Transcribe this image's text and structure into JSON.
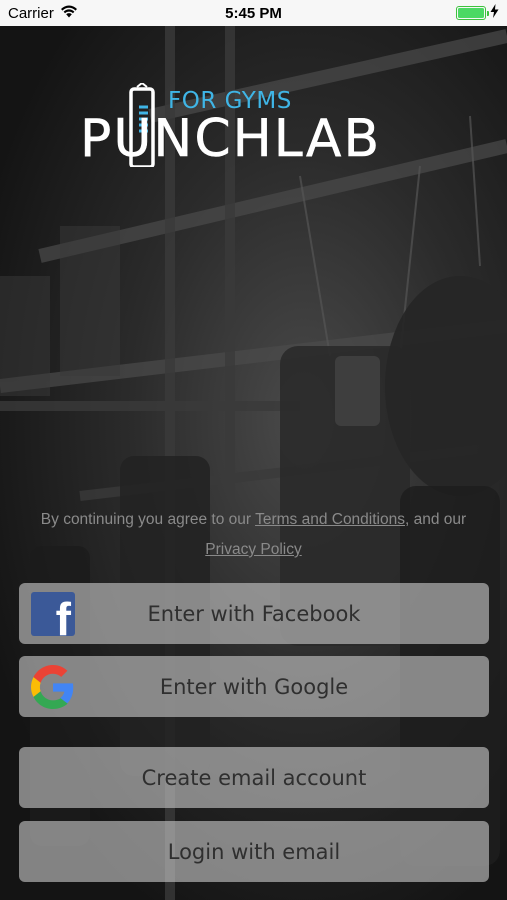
{
  "status_bar": {
    "carrier": "Carrier",
    "time": "5:45 PM",
    "battery_level": 1.0
  },
  "logo": {
    "subtitle": "FOR GYMS",
    "title": "PUNCHLAB",
    "icon": "punching-bag-icon"
  },
  "terms": {
    "prefix": "By continuing you agree to our ",
    "terms_link": "Terms and Conditions",
    "middle": ", and our ",
    "privacy_link": "Privacy Policy"
  },
  "buttons": {
    "facebook": {
      "label": "Enter with Facebook",
      "icon": "facebook-icon",
      "color": "#3b5998"
    },
    "google": {
      "label": "Enter with Google",
      "icon": "google-icon"
    },
    "create_email": {
      "label": "Create email account"
    },
    "login_email": {
      "label": "Login with email"
    }
  },
  "colors": {
    "accent": "#3fb5e6",
    "button_bg": "#c8c8c8",
    "battery": "#4cd964"
  }
}
